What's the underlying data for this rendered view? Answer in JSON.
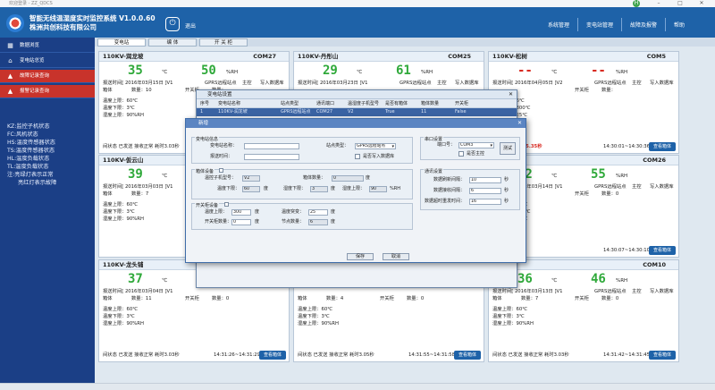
{
  "window": {
    "title": "欢迎登录 - ZZ_QDCS",
    "user_initial": "H"
  },
  "app": {
    "title_line1": "智能无线温湿度实时监控系统 V1.0.0.60",
    "title_line2": "株洲共创科技有限公司",
    "exit_icon": "⏻",
    "exit_label": "退出"
  },
  "topnav": [
    "系统管理",
    "变电站管理",
    "故障及报警",
    "帮助"
  ],
  "sidebar": {
    "items": [
      {
        "label": "数据浏览",
        "icon": "▦"
      },
      {
        "label": "变电站总览",
        "icon": "⌂"
      },
      {
        "label": "故障记录查询",
        "icon": "▲"
      },
      {
        "label": "报警记录查询",
        "icon": "▲"
      }
    ],
    "legend": [
      "KZ:监控子机状态",
      "FC:风机状态",
      "HS:温度传感器状态",
      "TS:温度传感器状态",
      "HL:温度负载状态",
      "TL:温度负载状态",
      "注:亮绿灯表示正常",
      "亮红灯表示故障"
    ]
  },
  "tabs": [
    "变电站",
    "编 体",
    "开 关 柜"
  ],
  "cards": [
    {
      "name": "110KV-润龙坡",
      "com": "COM27",
      "temp": "35",
      "hum": "50",
      "status": "normal",
      "report": "报送时间[ 2016年03月15日 ]V1",
      "gprs": "GPRS远程站点",
      "ctrl": "主控",
      "write": "写入数据库",
      "r1a": "箱体",
      "r1b": "数量：10",
      "r1c": "开关柜",
      "r1d": "数量：",
      "l1": "温度上限：60℃",
      "l2": "温度下限：3℃",
      "l3": "湿度上限：90%RH",
      "foot": "间状态 已发送 接收正常",
      "cost": "耗时3.03秒",
      "time": "",
      "btn": "查看箱体"
    },
    {
      "name": "110KV-丹彤山",
      "com": "COM25",
      "temp": "29",
      "hum": "61",
      "status": "normal",
      "report": "报送时间[ 2016年03月23日 ]V1",
      "gprs": "GPRS远程站点",
      "ctrl": "主控",
      "write": "写入数据库",
      "r1a": "",
      "r1b": "",
      "r1c": "",
      "r1d": "",
      "l1": "",
      "l2": "",
      "l3": "",
      "foot": "",
      "cost": "",
      "time": "",
      "btn": ""
    },
    {
      "name": "110KV-松树",
      "com": "COM5",
      "temp": "--",
      "hum": "--",
      "status": "alarm",
      "report": "报送时间[ 2016年04月05日 ]V2",
      "gprs": "GPRS远程站点",
      "ctrl": "主控",
      "write": "写入数据库",
      "r1a": "",
      "r1b": "",
      "r1c": "开关柜",
      "r1d": "数量：",
      "l1": "节点数据：6℃",
      "l2": "温度上限：300℃",
      "l3": "温度突变：25℃",
      "foot": "接收为空",
      "cost": "耗时35.35秒",
      "time": "14:30:01~14:30:36",
      "btn": "查看箱体"
    },
    {
      "name": "110KV-仮云山",
      "com": "",
      "temp": "39",
      "hum": "",
      "status": "normal",
      "report": "报送时间[ 2016年03月03日 ]V1",
      "gprs": "",
      "ctrl": "",
      "write": "",
      "r1a": "箱体",
      "r1b": "数量：7",
      "r1c": "",
      "r1d": "",
      "l1": "温度上限：60℃",
      "l2": "温度下限：3℃",
      "l3": "湿度上限：90%RH",
      "foot": "",
      "cost": "",
      "time": "",
      "btn": ""
    },
    {
      "name": "",
      "com": "",
      "temp": "",
      "hum": "",
      "status": "normal",
      "report": "",
      "gprs": "",
      "ctrl": "",
      "write": "",
      "r1a": "",
      "r1b": "",
      "r1c": "",
      "r1d": "",
      "l1": "",
      "l2": "",
      "l3": "",
      "foot": "",
      "cost": "",
      "time": "",
      "btn": ""
    },
    {
      "name": "",
      "com": "COM26",
      "temp": "32",
      "hum": "55",
      "status": "normal",
      "report": "报送时间[ 2016年03月14日 ]V1",
      "gprs": "GPRS远程站点",
      "ctrl": "主控",
      "write": "写入数据库",
      "r1a": "",
      "r1b": "",
      "r1c": "开关柜",
      "r1d": "数量：0",
      "l1": "节点数据：60℃",
      "l2": "温度上限：300℃",
      "l3": "温度突变：25℃",
      "foot": "",
      "cost": "",
      "time": "14:30:07~14:30:10",
      "btn": "查看箱体"
    },
    {
      "name": "110KV-龙头铺",
      "com": "",
      "temp": "37",
      "hum": "",
      "status": "normal",
      "report": "报送时间[ 2016年03月04日 ]V1",
      "gprs": "",
      "ctrl": "",
      "write": "",
      "r1a": "箱体",
      "r1b": "数量：11",
      "r1c": "开关柜",
      "r1d": "数量：0",
      "l1": "温度上限：60℃",
      "l2": "温度下限：3℃",
      "l3": "湿度上限：90%RH",
      "foot": "间状态 已发送 接收正常",
      "cost": "耗时3.03秒",
      "time": "14:31:26~14:31:29",
      "btn": "查看箱体"
    },
    {
      "name": "",
      "com": "",
      "temp": "",
      "hum": "",
      "status": "normal",
      "report": "",
      "gprs": "",
      "ctrl": "",
      "write": "",
      "r1a": "箱体",
      "r1b": "数量：4",
      "r1c": "开关柜",
      "r1d": "数量：0",
      "l1": "温度上限：60℃",
      "l2": "温度下限：3℃",
      "l3": "湿度上限：90%RH",
      "foot": "间状态 已发送 接收正常",
      "cost": "耗时3.05秒",
      "time": "14:31:55~14:31:58",
      "btn": "查看箱体"
    },
    {
      "name": "",
      "com": "COM10",
      "temp": "36",
      "hum": "46",
      "status": "normal",
      "report": "报送时间[ 2016年03月13日 ]V1",
      "gprs": "GPRS远程站点",
      "ctrl": "主控",
      "write": "写入数据库",
      "r1a": "箱体",
      "r1b": "数量：7",
      "r1c": "开关柜",
      "r1d": "数量：0",
      "l1": "温度上限：60℃",
      "l2": "温度下限：3℃",
      "l3": "湿度上限：90%RH",
      "foot": "间状态 已发送 接收正常",
      "cost": "耗时3.03秒",
      "time": "14:31:42~14:31:45",
      "btn": "查看箱体"
    }
  ],
  "units": {
    "temp": "℃",
    "hum": "%RH"
  },
  "dialog_list": {
    "title": "变电站设置",
    "columns": [
      "序号",
      "变电站名称",
      "站点类型",
      "通讯端口",
      "温湿度子机型号",
      "是否有箱体",
      "箱体数量",
      "开关柜"
    ],
    "row": [
      "1",
      "110KV-润龙坡",
      "GPRS远程站点",
      "COM27",
      "V2",
      "True",
      "11",
      "False"
    ]
  },
  "dialog_new": {
    "title": "新增",
    "sec_station": "变电站信息",
    "lbl_name": "变电站名称：",
    "name_value": "",
    "lbl_type": "站点类型：",
    "type_value": "GPRS远程站点",
    "lbl_report": "报送时间：",
    "report_value": "",
    "lbl_write": "是否写入数据库",
    "sec_box": "箱体设备",
    "lbl_model": "温控子机型号：",
    "model_value": "V2",
    "lbl_box_count": "箱体数量：",
    "box_count_value": "0",
    "lbl_temp_lower": "温度下限：",
    "temp_lower_value": "60",
    "lbl_hum_lower": "湿度下限：",
    "hum_lower_value": "3",
    "lbl_hum_upper": "湿度上限：",
    "hum_upper_value": "90",
    "unit_c": "度",
    "unit_rh": "%RH",
    "sec_switch": "开关柜设备",
    "lbl_sw_temp": "温度上限：",
    "sw_temp_value": "300",
    "lbl_sw_jump": "温度突变：",
    "sw_jump_value": "25",
    "lbl_sw_count": "开关柜数量：",
    "sw_count_value": "0",
    "lbl_node": "节点数量：",
    "node_value": "6",
    "sec_port": "串口设置",
    "lbl_port": "端口号：",
    "port_value": "COM3",
    "lbl_main": "是否主控",
    "test_btn": "测试",
    "sec_comm": "通讯设置",
    "lbl_poll": "数据刷新间隔：",
    "poll_value": "10",
    "lbl_retry": "数据接收间隔：",
    "retry_value": "6",
    "lbl_resend": "数据超时重发时间：",
    "resend_value": "16",
    "unit_s": "秒",
    "save_btn": "保存",
    "cancel_btn": "取消"
  }
}
